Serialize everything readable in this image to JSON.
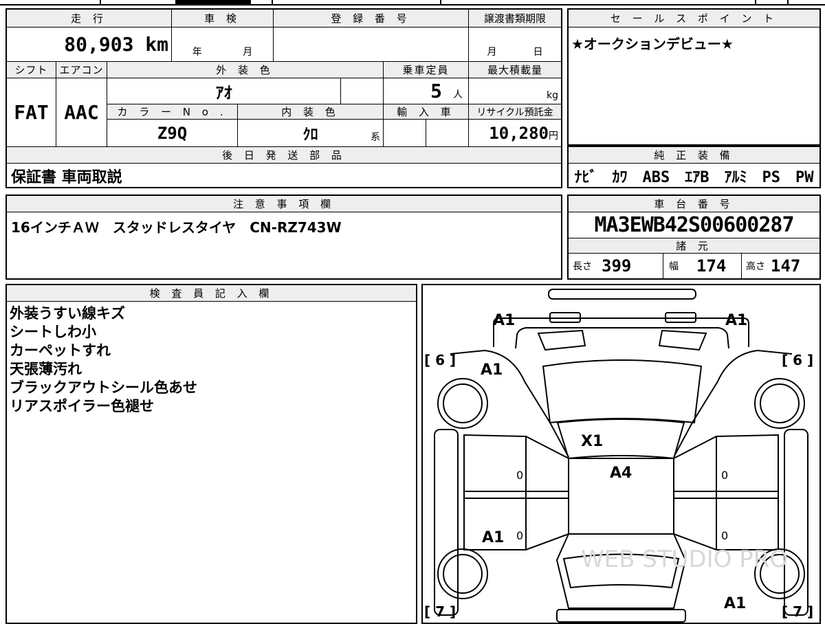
{
  "headers": {
    "mileage": "走 行",
    "inspection": "車 検",
    "registration": "登 録 番 号",
    "transfer_deadline": "譲渡書類期限",
    "shift": "シフト",
    "aircon": "エアコン",
    "exterior_color": "外 装 色",
    "capacity": "乗車定員",
    "max_load": "最大積載量",
    "color_no": "カ ラ ー N o .",
    "interior_color": "内 装 色",
    "import": "輸 入 車",
    "recycle": "リサイクル預託金",
    "later_parts": "後 日 発 送 部 品",
    "notes": "注 意 事 項 欄",
    "inspector": "検 査 員 記 入 欄",
    "sales_points": "セ ー ル ス ポ イ ン ト",
    "genuine_equipment": "純 正 装 備",
    "chassis_no": "車 台 番 号",
    "specs": "諸 元"
  },
  "values": {
    "mileage": "80,903 km",
    "inspection_year_unit": "年",
    "inspection_month_unit": "月",
    "transfer_month_unit": "月",
    "transfer_day_unit": "日",
    "shift": "FAT",
    "aircon": "AAC",
    "exterior_color": "ｱｵ",
    "capacity": "5",
    "capacity_unit": "人",
    "max_load_unit": "kg",
    "color_no": "Z9Q",
    "interior_color": "ｸﾛ",
    "interior_suffix": "系",
    "recycle": "10,280",
    "recycle_unit": "円",
    "later_parts": "保証書 車両取説",
    "notes": "16インチＡＷ　スタッドレスタイヤ　CN-RZ743W",
    "inspector_lines": [
      "外装うすい線キズ",
      "シートしわ小",
      "カーペットすれ",
      "天張薄汚れ",
      "ブラックアウトシール色あせ",
      "リアスポイラー色褪せ"
    ],
    "sales_points": "★オークションデビュー★",
    "genuine_equipment": "ﾅﾋﾞ　ｶﾜ　ABS　ｴｱB　ｱﾙﾐ　PS　PW",
    "chassis_no": "MA3EWB42S00600287",
    "length_label": "長さ",
    "length": "399",
    "width_label": "幅",
    "width": "174",
    "height_label": "高さ",
    "height": "147"
  },
  "diagram": {
    "marks": {
      "front_left_corner": "A1",
      "front_right_corner": "A1",
      "front_left_fender": "A1",
      "roof_front": "X1",
      "roof": "A4",
      "rear_left": "A1",
      "rear_right_corner": "A1",
      "left_door_upper": "0",
      "left_door_lower": "0",
      "right_door_upper": "0",
      "right_door_lower": "0"
    },
    "tire_labels": {
      "front_left": "[ 6 ]",
      "front_right": "[ 6 ]",
      "rear_left": "[ 7 ]",
      "rear_right": "[ 7 ]"
    },
    "watermark": "WEB STUDIO PRO"
  }
}
